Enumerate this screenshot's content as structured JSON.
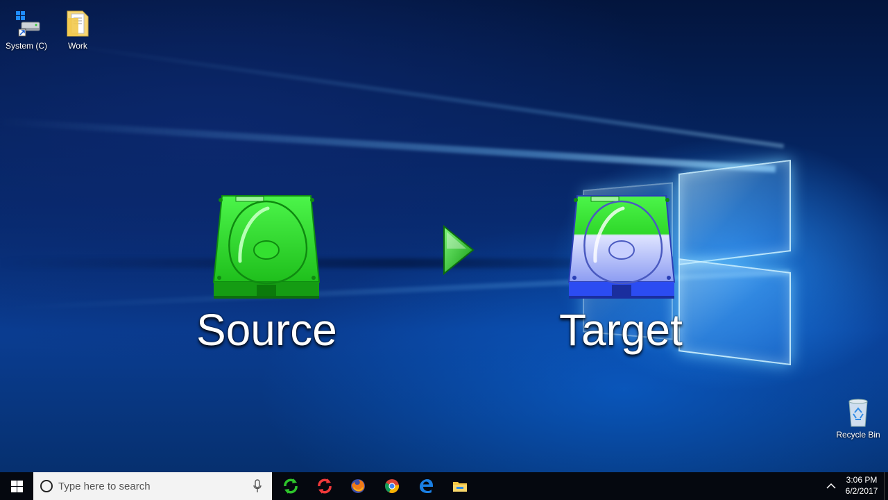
{
  "desktop": {
    "icons": [
      {
        "label": "System (C)",
        "icon": "drive-icon"
      },
      {
        "label": "Work",
        "icon": "folder-icon"
      },
      {
        "label": "Recycle Bin",
        "icon": "recycle-bin-icon"
      }
    ],
    "wallpaper": {
      "accent": "#1e8cff",
      "base": "#062a6e"
    }
  },
  "diagram": {
    "source_label": "Source",
    "target_label": "Target",
    "colors": {
      "drive_green": "#2fd82a",
      "drive_blue": "#2b4cf2",
      "arrow": "#2db52a"
    }
  },
  "taskbar": {
    "search_placeholder": "Type here to search",
    "apps": [
      {
        "name": "sync-green",
        "icon": "sync-icon"
      },
      {
        "name": "sync-red",
        "icon": "sync-icon"
      },
      {
        "name": "Firefox",
        "icon": "firefox-icon"
      },
      {
        "name": "Chrome",
        "icon": "chrome-icon"
      },
      {
        "name": "Edge",
        "icon": "edge-icon"
      },
      {
        "name": "File Explorer",
        "icon": "file-explorer-icon"
      }
    ],
    "clock": {
      "time": "3:06 PM",
      "date": "6/2/2017"
    }
  }
}
